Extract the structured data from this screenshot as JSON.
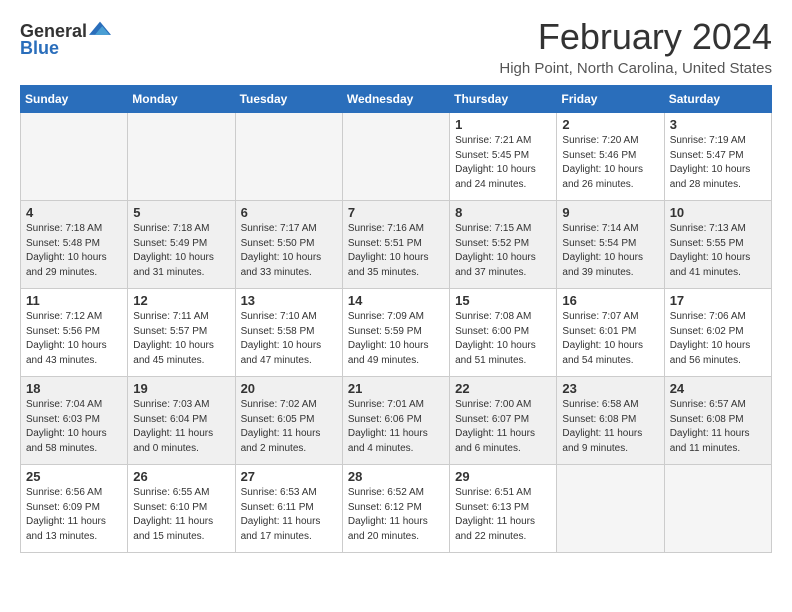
{
  "logo": {
    "text_general": "General",
    "text_blue": "Blue"
  },
  "title": "February 2024",
  "subtitle": "High Point, North Carolina, United States",
  "days_of_week": [
    "Sunday",
    "Monday",
    "Tuesday",
    "Wednesday",
    "Thursday",
    "Friday",
    "Saturday"
  ],
  "weeks": [
    {
      "shaded": false,
      "days": [
        {
          "number": "",
          "info": "",
          "empty": true
        },
        {
          "number": "",
          "info": "",
          "empty": true
        },
        {
          "number": "",
          "info": "",
          "empty": true
        },
        {
          "number": "",
          "info": "",
          "empty": true
        },
        {
          "number": "1",
          "info": "Sunrise: 7:21 AM\nSunset: 5:45 PM\nDaylight: 10 hours\nand 24 minutes.",
          "empty": false
        },
        {
          "number": "2",
          "info": "Sunrise: 7:20 AM\nSunset: 5:46 PM\nDaylight: 10 hours\nand 26 minutes.",
          "empty": false
        },
        {
          "number": "3",
          "info": "Sunrise: 7:19 AM\nSunset: 5:47 PM\nDaylight: 10 hours\nand 28 minutes.",
          "empty": false
        }
      ]
    },
    {
      "shaded": true,
      "days": [
        {
          "number": "4",
          "info": "Sunrise: 7:18 AM\nSunset: 5:48 PM\nDaylight: 10 hours\nand 29 minutes.",
          "empty": false
        },
        {
          "number": "5",
          "info": "Sunrise: 7:18 AM\nSunset: 5:49 PM\nDaylight: 10 hours\nand 31 minutes.",
          "empty": false
        },
        {
          "number": "6",
          "info": "Sunrise: 7:17 AM\nSunset: 5:50 PM\nDaylight: 10 hours\nand 33 minutes.",
          "empty": false
        },
        {
          "number": "7",
          "info": "Sunrise: 7:16 AM\nSunset: 5:51 PM\nDaylight: 10 hours\nand 35 minutes.",
          "empty": false
        },
        {
          "number": "8",
          "info": "Sunrise: 7:15 AM\nSunset: 5:52 PM\nDaylight: 10 hours\nand 37 minutes.",
          "empty": false
        },
        {
          "number": "9",
          "info": "Sunrise: 7:14 AM\nSunset: 5:54 PM\nDaylight: 10 hours\nand 39 minutes.",
          "empty": false
        },
        {
          "number": "10",
          "info": "Sunrise: 7:13 AM\nSunset: 5:55 PM\nDaylight: 10 hours\nand 41 minutes.",
          "empty": false
        }
      ]
    },
    {
      "shaded": false,
      "days": [
        {
          "number": "11",
          "info": "Sunrise: 7:12 AM\nSunset: 5:56 PM\nDaylight: 10 hours\nand 43 minutes.",
          "empty": false
        },
        {
          "number": "12",
          "info": "Sunrise: 7:11 AM\nSunset: 5:57 PM\nDaylight: 10 hours\nand 45 minutes.",
          "empty": false
        },
        {
          "number": "13",
          "info": "Sunrise: 7:10 AM\nSunset: 5:58 PM\nDaylight: 10 hours\nand 47 minutes.",
          "empty": false
        },
        {
          "number": "14",
          "info": "Sunrise: 7:09 AM\nSunset: 5:59 PM\nDaylight: 10 hours\nand 49 minutes.",
          "empty": false
        },
        {
          "number": "15",
          "info": "Sunrise: 7:08 AM\nSunset: 6:00 PM\nDaylight: 10 hours\nand 51 minutes.",
          "empty": false
        },
        {
          "number": "16",
          "info": "Sunrise: 7:07 AM\nSunset: 6:01 PM\nDaylight: 10 hours\nand 54 minutes.",
          "empty": false
        },
        {
          "number": "17",
          "info": "Sunrise: 7:06 AM\nSunset: 6:02 PM\nDaylight: 10 hours\nand 56 minutes.",
          "empty": false
        }
      ]
    },
    {
      "shaded": true,
      "days": [
        {
          "number": "18",
          "info": "Sunrise: 7:04 AM\nSunset: 6:03 PM\nDaylight: 10 hours\nand 58 minutes.",
          "empty": false
        },
        {
          "number": "19",
          "info": "Sunrise: 7:03 AM\nSunset: 6:04 PM\nDaylight: 11 hours\nand 0 minutes.",
          "empty": false
        },
        {
          "number": "20",
          "info": "Sunrise: 7:02 AM\nSunset: 6:05 PM\nDaylight: 11 hours\nand 2 minutes.",
          "empty": false
        },
        {
          "number": "21",
          "info": "Sunrise: 7:01 AM\nSunset: 6:06 PM\nDaylight: 11 hours\nand 4 minutes.",
          "empty": false
        },
        {
          "number": "22",
          "info": "Sunrise: 7:00 AM\nSunset: 6:07 PM\nDaylight: 11 hours\nand 6 minutes.",
          "empty": false
        },
        {
          "number": "23",
          "info": "Sunrise: 6:58 AM\nSunset: 6:08 PM\nDaylight: 11 hours\nand 9 minutes.",
          "empty": false
        },
        {
          "number": "24",
          "info": "Sunrise: 6:57 AM\nSunset: 6:08 PM\nDaylight: 11 hours\nand 11 minutes.",
          "empty": false
        }
      ]
    },
    {
      "shaded": false,
      "days": [
        {
          "number": "25",
          "info": "Sunrise: 6:56 AM\nSunset: 6:09 PM\nDaylight: 11 hours\nand 13 minutes.",
          "empty": false
        },
        {
          "number": "26",
          "info": "Sunrise: 6:55 AM\nSunset: 6:10 PM\nDaylight: 11 hours\nand 15 minutes.",
          "empty": false
        },
        {
          "number": "27",
          "info": "Sunrise: 6:53 AM\nSunset: 6:11 PM\nDaylight: 11 hours\nand 17 minutes.",
          "empty": false
        },
        {
          "number": "28",
          "info": "Sunrise: 6:52 AM\nSunset: 6:12 PM\nDaylight: 11 hours\nand 20 minutes.",
          "empty": false
        },
        {
          "number": "29",
          "info": "Sunrise: 6:51 AM\nSunset: 6:13 PM\nDaylight: 11 hours\nand 22 minutes.",
          "empty": false
        },
        {
          "number": "",
          "info": "",
          "empty": true
        },
        {
          "number": "",
          "info": "",
          "empty": true
        }
      ]
    }
  ]
}
